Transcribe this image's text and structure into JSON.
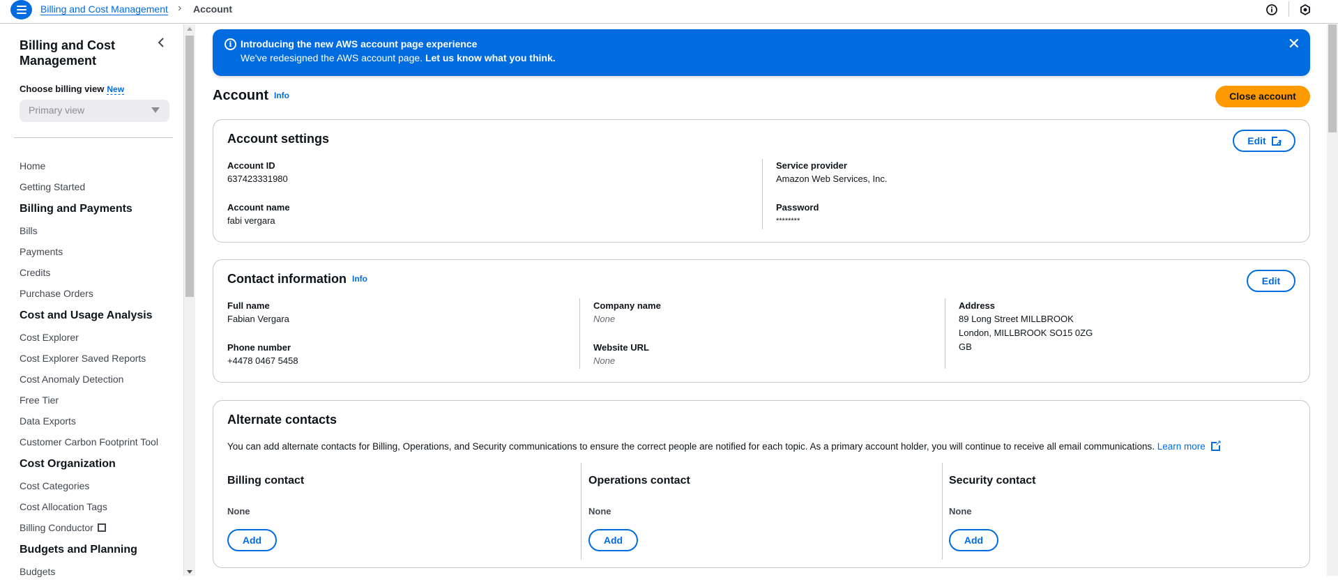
{
  "header": {
    "breadcrumb": [
      {
        "label": "Billing and Cost Management"
      },
      {
        "label": "Account"
      }
    ],
    "icons": [
      "menu-icon",
      "info-icon",
      "settings-hex-icon"
    ]
  },
  "sidebar": {
    "title": "Billing and Cost Management",
    "billing_view_label": "Choose billing view",
    "billing_view_badge": "New",
    "billing_view_selected": "Primary view",
    "items": [
      {
        "label": "Home",
        "type": "link"
      },
      {
        "label": "Getting Started",
        "type": "link"
      },
      {
        "label": "Billing and Payments",
        "type": "section"
      },
      {
        "label": "Bills",
        "type": "link"
      },
      {
        "label": "Payments",
        "type": "link"
      },
      {
        "label": "Credits",
        "type": "link"
      },
      {
        "label": "Purchase Orders",
        "type": "link"
      },
      {
        "label": "Cost and Usage Analysis",
        "type": "section"
      },
      {
        "label": "Cost Explorer",
        "type": "link"
      },
      {
        "label": "Cost Explorer Saved Reports",
        "type": "link"
      },
      {
        "label": "Cost Anomaly Detection",
        "type": "link"
      },
      {
        "label": "Free Tier",
        "type": "link"
      },
      {
        "label": "Data Exports",
        "type": "link"
      },
      {
        "label": "Customer Carbon Footprint Tool",
        "type": "link"
      },
      {
        "label": "Cost Organization",
        "type": "section"
      },
      {
        "label": "Cost Categories",
        "type": "link"
      },
      {
        "label": "Cost Allocation Tags",
        "type": "link"
      },
      {
        "label": "Billing Conductor",
        "type": "external"
      },
      {
        "label": "Budgets and Planning",
        "type": "section"
      },
      {
        "label": "Budgets",
        "type": "link"
      }
    ]
  },
  "banner": {
    "title": "Introducing the new AWS account page experience",
    "text": "We've redesigned the AWS account page.",
    "link": "Let us know what you think."
  },
  "page": {
    "title": "Account",
    "info": "Info",
    "close_account": "Close account"
  },
  "account_settings": {
    "title": "Account settings",
    "edit": "Edit",
    "account_id_label": "Account ID",
    "account_id": "637423331980",
    "account_name_label": "Account name",
    "account_name": "fabi vergara",
    "service_provider_label": "Service provider",
    "service_provider": "Amazon Web Services, Inc.",
    "password_label": "Password",
    "password": "********"
  },
  "contact_info": {
    "title": "Contact information",
    "info": "Info",
    "edit": "Edit",
    "full_name_label": "Full name",
    "full_name": "Fabian Vergara",
    "phone_label": "Phone number",
    "phone": "+4478 0467 5458",
    "company_label": "Company name",
    "company": "None",
    "website_label": "Website URL",
    "website": "None",
    "address_label": "Address",
    "address_line1": "89 Long Street MILLBROOK",
    "address_line2": "London, MILLBROOK SO15 0ZG",
    "address_line3": "GB"
  },
  "alternate_contacts": {
    "title": "Alternate contacts",
    "description": "You can add alternate contacts for Billing, Operations, and Security communications to ensure the correct people are notified for each topic. As a primary account holder, you will continue to receive all email communications.",
    "learn_more": "Learn more",
    "columns": [
      {
        "title": "Billing contact",
        "value": "None",
        "button": "Add"
      },
      {
        "title": "Operations contact",
        "value": "None",
        "button": "Add"
      },
      {
        "title": "Security contact",
        "value": "None",
        "button": "Add"
      }
    ]
  },
  "colors": {
    "primary": "#006ce0",
    "warning_button": "#ff9900",
    "text": "#0f141a",
    "border": "#c6c6cd"
  }
}
